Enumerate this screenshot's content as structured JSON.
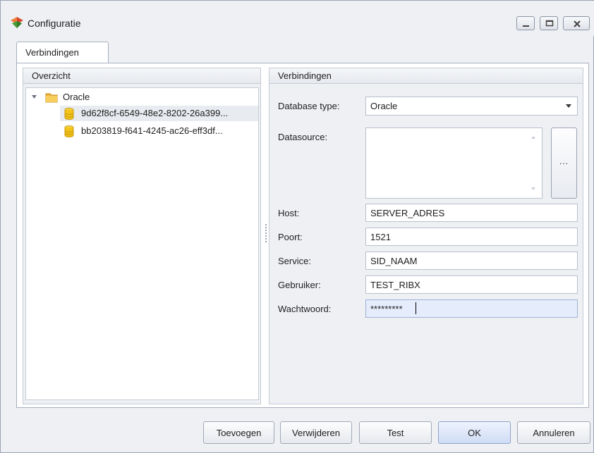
{
  "window": {
    "title": "Configuratie"
  },
  "tabs": [
    {
      "label": "Verbindingen",
      "active": true
    }
  ],
  "overview": {
    "header": "Overzicht",
    "tree": {
      "root": {
        "label": "Oracle",
        "icon": "folder-icon",
        "expanded": true
      },
      "children": [
        {
          "label": "9d62f8cf-6549-48e2-8202-26a399...",
          "icon": "database-icon",
          "selected": true
        },
        {
          "label": "bb203819-f641-4245-ac26-eff3df...",
          "icon": "database-icon",
          "selected": false
        }
      ]
    }
  },
  "connection": {
    "header": "Verbindingen",
    "database_type": {
      "label": "Database type:",
      "value": "Oracle"
    },
    "datasource": {
      "label": "Datasource:",
      "value": "",
      "browse_label": "..."
    },
    "host": {
      "label": "Host:",
      "value": "SERVER_ADRES"
    },
    "port": {
      "label": "Poort:",
      "value": "1521"
    },
    "service": {
      "label": "Service:",
      "value": "SID_NAAM"
    },
    "user": {
      "label": "Gebruiker:",
      "value": "TEST_RIBX"
    },
    "password": {
      "label": "Wachtwoord:",
      "value": "*********"
    }
  },
  "buttons": {
    "add": "Toevoegen",
    "remove": "Verwijderen",
    "test": "Test",
    "ok": "OK",
    "cancel": "Annuleren"
  },
  "colors": {
    "window_bg": "#eef0f4",
    "focused_field": "#e5ecfb",
    "primary_button": "#cfdcf5",
    "folder": "#f0b43c",
    "database": "#f2c318"
  }
}
